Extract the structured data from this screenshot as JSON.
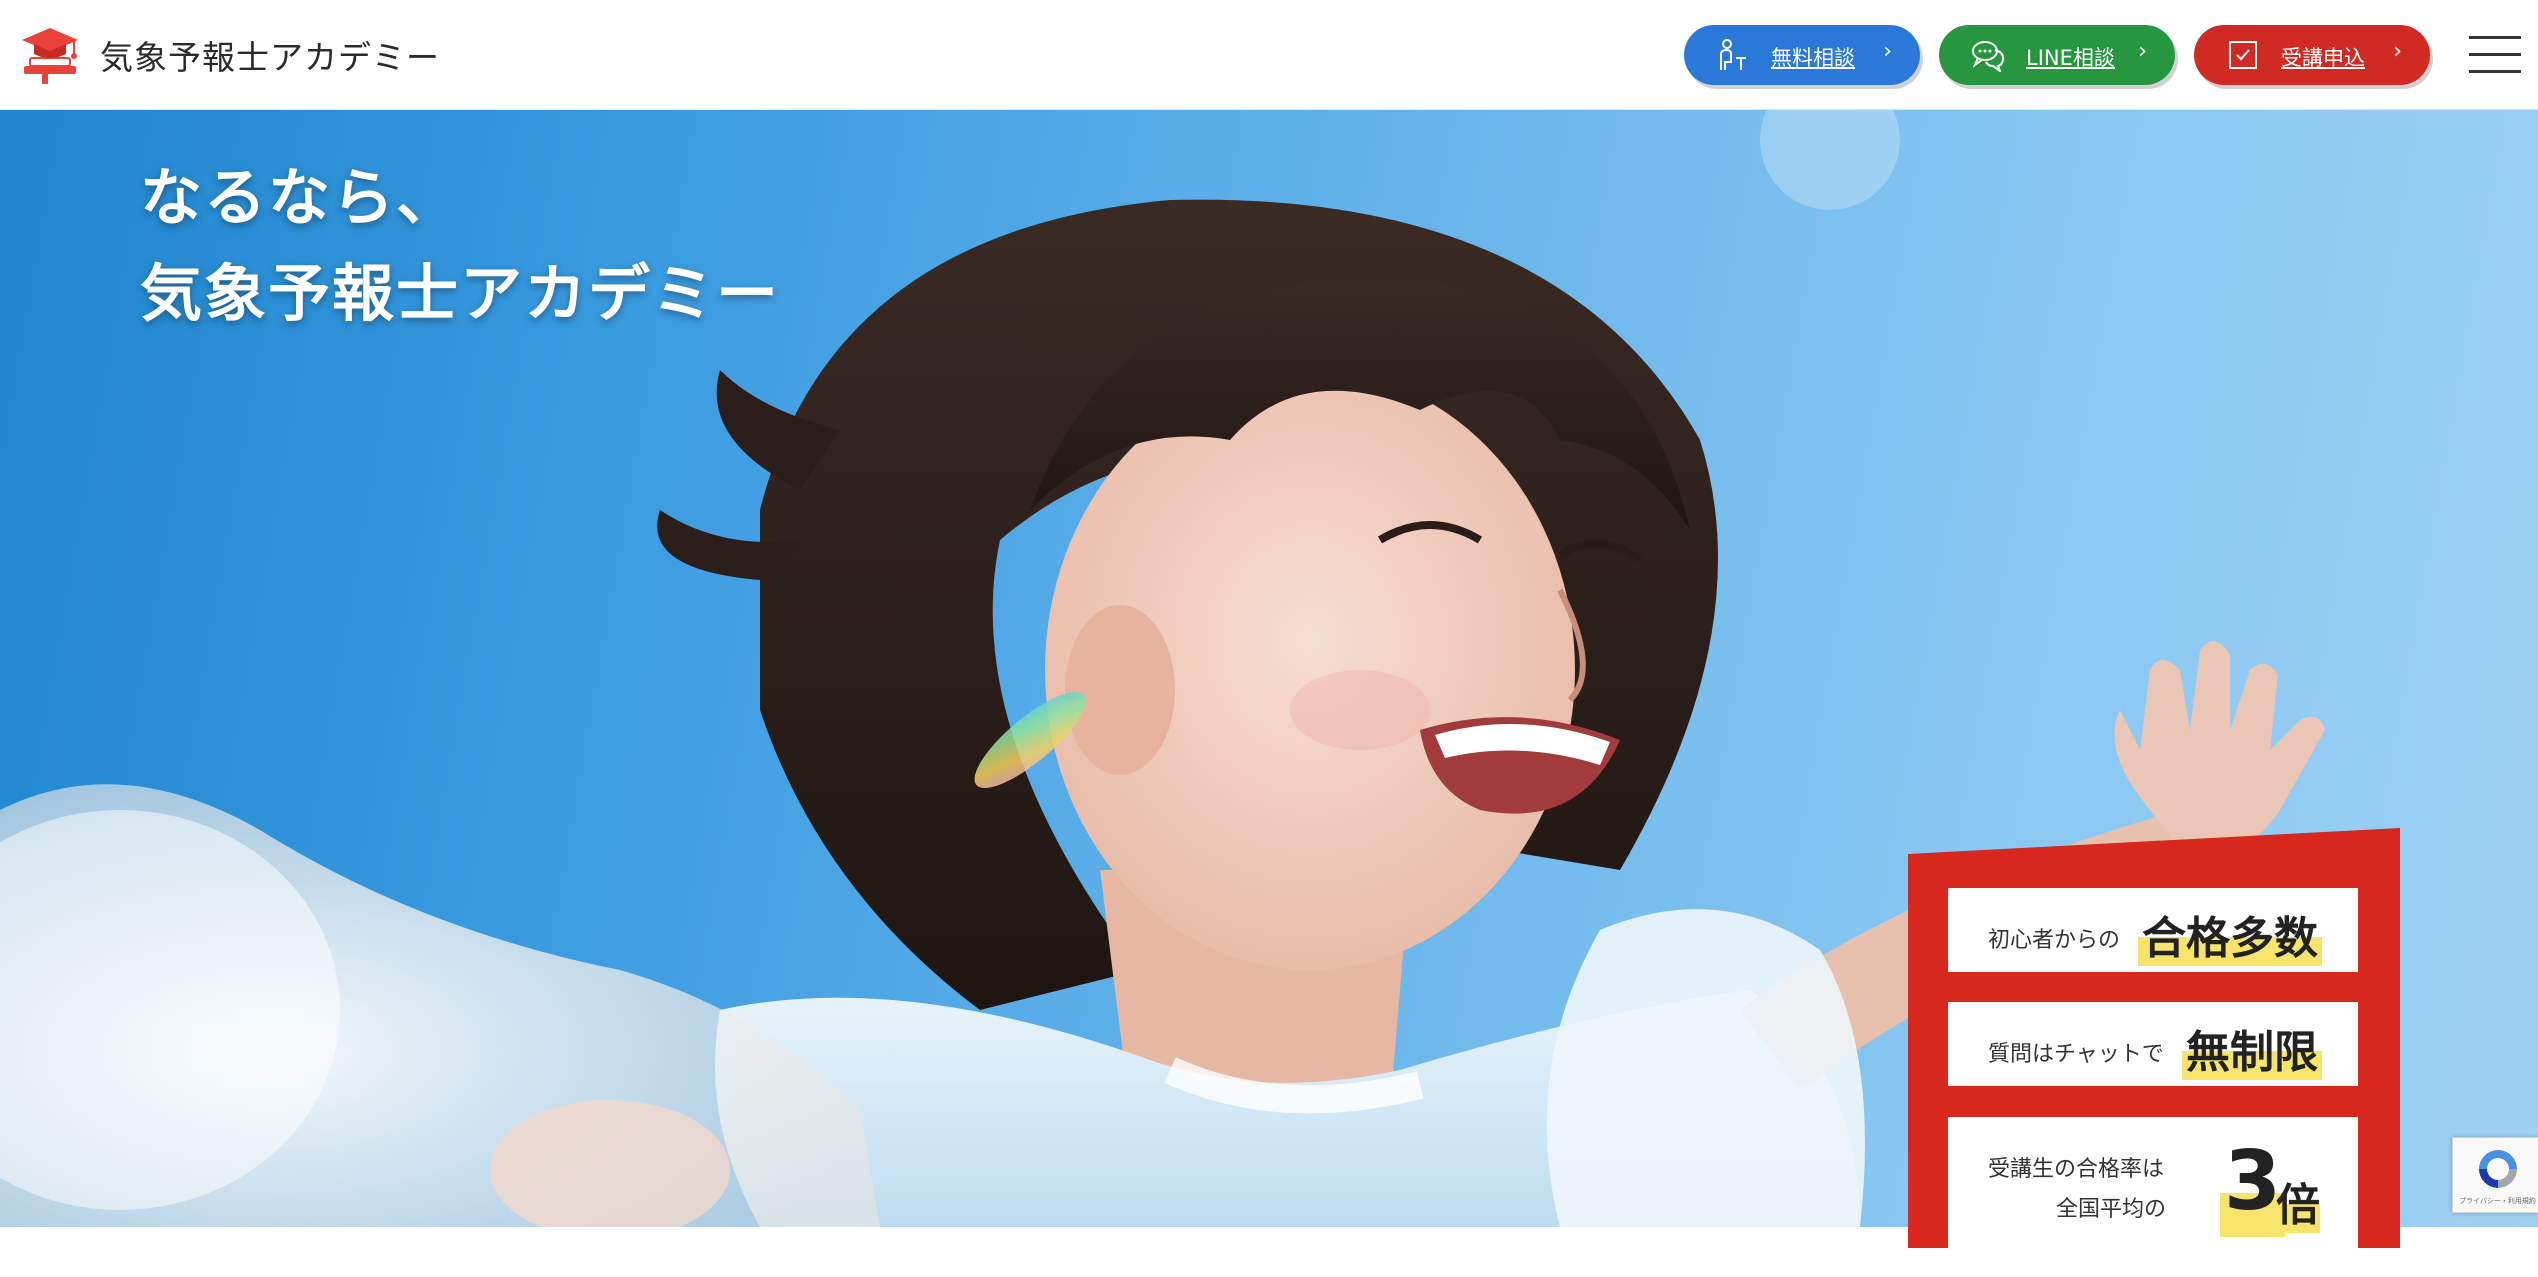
{
  "brand": {
    "name": "気象予報士アカデミー",
    "accent_red": "#d12a22",
    "accent_blue": "#2a78d8",
    "accent_green": "#26973f"
  },
  "header": {
    "buttons": [
      {
        "label": "無料相談",
        "icon": "consultation-icon"
      },
      {
        "label": "LINE相談",
        "icon": "chat-bubbles-icon"
      },
      {
        "label": "受講申込",
        "icon": "checkbox-icon"
      }
    ],
    "menu_icon": "hamburger-menu-icon"
  },
  "hero": {
    "headline_line1": "なるなら、",
    "headline_line2": "気象予報士アカデミー"
  },
  "features": {
    "item1": {
      "small": "初心者からの",
      "big": "合格多数"
    },
    "item2": {
      "small": "質問はチャットで",
      "big": "無制限"
    },
    "item3": {
      "line1": "受講生の合格率は",
      "line2": "全国平均の",
      "number": "3",
      "unit": "倍"
    }
  },
  "recaptcha": {
    "text": "プライバシー・利用規約"
  }
}
